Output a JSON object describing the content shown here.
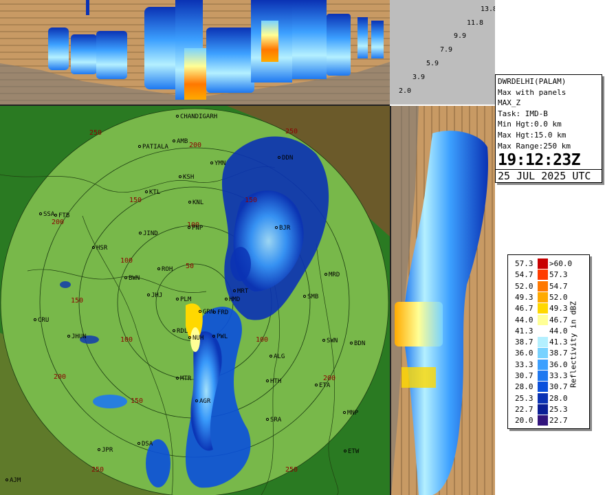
{
  "station": "DWRDELHI(PALAM)",
  "product_desc": "Max with panels",
  "product": "MAX_Z",
  "task": "Task: IMD-B",
  "min_hgt": "Min Hgt:0.0 km",
  "max_hgt": "Max Hgt:15.0 km",
  "max_range": "Max Range:250 km",
  "time": "19:12:23Z",
  "date": "25 JUL 2025 UTC",
  "height_labels": [
    "13.8",
    "11.8",
    "9.9",
    "7.9",
    "5.9",
    "3.9",
    "2.0"
  ],
  "legend_title": "Reflectivity in dBZ",
  "legend": [
    {
      "low": "57.3",
      "high": ">60.0",
      "color": "#c80000"
    },
    {
      "low": "54.7",
      "high": "57.3",
      "color": "#ff3c00"
    },
    {
      "low": "52.0",
      "high": "54.7",
      "color": "#ff7800"
    },
    {
      "low": "49.3",
      "high": "52.0",
      "color": "#ffaa00"
    },
    {
      "low": "46.7",
      "high": "49.3",
      "color": "#ffd800"
    },
    {
      "low": "44.0",
      "high": "46.7",
      "color": "#ffff96"
    },
    {
      "low": "41.3",
      "high": "44.0",
      "color": "#ffffff"
    },
    {
      "low": "38.7",
      "high": "41.3",
      "color": "#b4f0ff"
    },
    {
      "low": "36.0",
      "high": "38.7",
      "color": "#78d2ff"
    },
    {
      "low": "33.3",
      "high": "36.0",
      "color": "#3ca0ff"
    },
    {
      "low": "30.7",
      "high": "33.3",
      "color": "#1e78f0"
    },
    {
      "low": "28.0",
      "high": "30.7",
      "color": "#0a50dc"
    },
    {
      "low": "25.3",
      "high": "28.0",
      "color": "#0a32b4"
    },
    {
      "low": "22.7",
      "high": "25.3",
      "color": "#0a1e96"
    },
    {
      "low": "20.0",
      "high": "22.7",
      "color": "#32147d"
    }
  ],
  "range_labels": [
    "50",
    "100",
    "150",
    "200",
    "250"
  ],
  "cities": [
    {
      "name": "CHANDIGARH"
    },
    {
      "name": "PATIALA"
    },
    {
      "name": "AMB"
    },
    {
      "name": "YMN"
    },
    {
      "name": "DDN"
    },
    {
      "name": "KSH"
    },
    {
      "name": "KTL"
    },
    {
      "name": "KNL"
    },
    {
      "name": "SSA"
    },
    {
      "name": "FTB"
    },
    {
      "name": "JIND"
    },
    {
      "name": "PNP"
    },
    {
      "name": "BJR"
    },
    {
      "name": "HSR"
    },
    {
      "name": "ROH"
    },
    {
      "name": "BWN"
    },
    {
      "name": "MRD"
    },
    {
      "name": "JHJ"
    },
    {
      "name": "PLM"
    },
    {
      "name": "HMD"
    },
    {
      "name": "MRT"
    },
    {
      "name": "SMB"
    },
    {
      "name": "CRU"
    },
    {
      "name": "GRN"
    },
    {
      "name": "FRD"
    },
    {
      "name": "RDL"
    },
    {
      "name": "PWL"
    },
    {
      "name": "JHUN"
    },
    {
      "name": "SWN"
    },
    {
      "name": "BDN"
    },
    {
      "name": "NUH"
    },
    {
      "name": "ALG"
    },
    {
      "name": "HTH"
    },
    {
      "name": "ETA"
    },
    {
      "name": "SRA"
    },
    {
      "name": "MNP"
    },
    {
      "name": "DSA"
    },
    {
      "name": "JPR"
    },
    {
      "name": "ETW"
    },
    {
      "name": "AJM"
    },
    {
      "name": "AGR"
    },
    {
      "name": "MTR"
    }
  ]
}
